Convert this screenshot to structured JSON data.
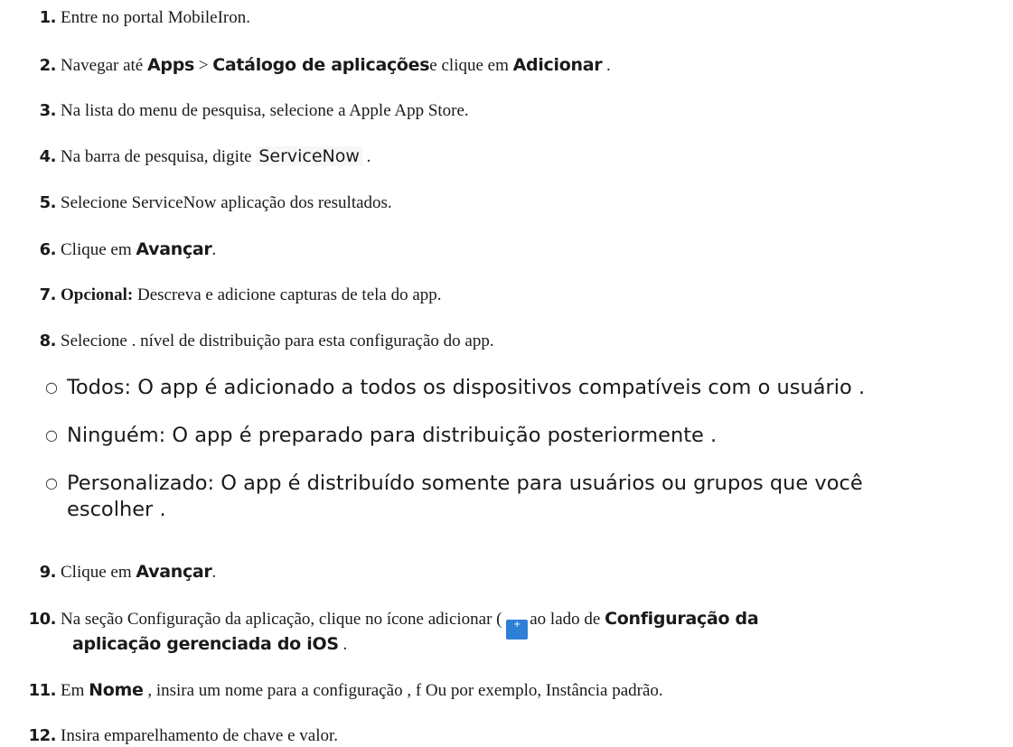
{
  "steps": [
    {
      "n": "1.",
      "text": "Entre no portal MobileIron."
    },
    {
      "n": "2.",
      "a": "Navegar até ",
      "b": "Apps",
      "c": " > ",
      "d": "Catálogo de aplicações",
      "e": "e clique em ",
      "f": "Adicionar",
      "g": " ."
    },
    {
      "n": "3.",
      "text": "Na lista do menu de pesquisa, selecione a Apple App Store."
    },
    {
      "n": "4.",
      "a": "Na barra de pesquisa, digite ",
      "code": "ServiceNow",
      "g": " ."
    },
    {
      "n": "5.",
      "text": "Selecione ServiceNow aplicação dos resultados."
    },
    {
      "n": "6.",
      "a": "Clique em ",
      "b": "Avançar",
      "g": "."
    },
    {
      "n": "7.",
      "b": "Opcional:",
      "a": " Descreva e adicione capturas de tela do app."
    },
    {
      "n": "8.",
      "text": "Selecione . nível de distribuição para esta configuração do app."
    },
    {
      "n": "9.",
      "a": "Clique em ",
      "b": "Avançar",
      "g": "."
    },
    {
      "n": "10.",
      "a": "Na seção Configuração da aplicação, clique no ícone adicionar ( ",
      "icon": "+",
      "c": "ao lado de ",
      "d": "Configuração da",
      "e": "aplicação gerenciada do iOS",
      "g": " ."
    },
    {
      "n": "11.",
      "a": "Em ",
      "b": "Nome",
      "c": " , insira um nome para a configuração , f Ou por exemplo, Instância padrão."
    },
    {
      "n": "12.",
      "text": "Insira emparelhamento de chave e valor."
    }
  ],
  "distribution": [
    {
      "text": "Todos: O app é adicionado a todos os dispositivos compatíveis com o usuário ."
    },
    {
      "text": "Ninguém: O app é preparado para distribuição posteriormente ."
    },
    {
      "line1": "Personalizado: O app é distribuído somente para usuários ou grupos que você",
      "line2": "escolher ."
    }
  ],
  "icons": {
    "bullet": "hollow-circle-icon",
    "add": "add-plus-icon"
  },
  "colors": {
    "text": "#1a1a1a",
    "add_icon_bg": "#2e7fd6"
  }
}
